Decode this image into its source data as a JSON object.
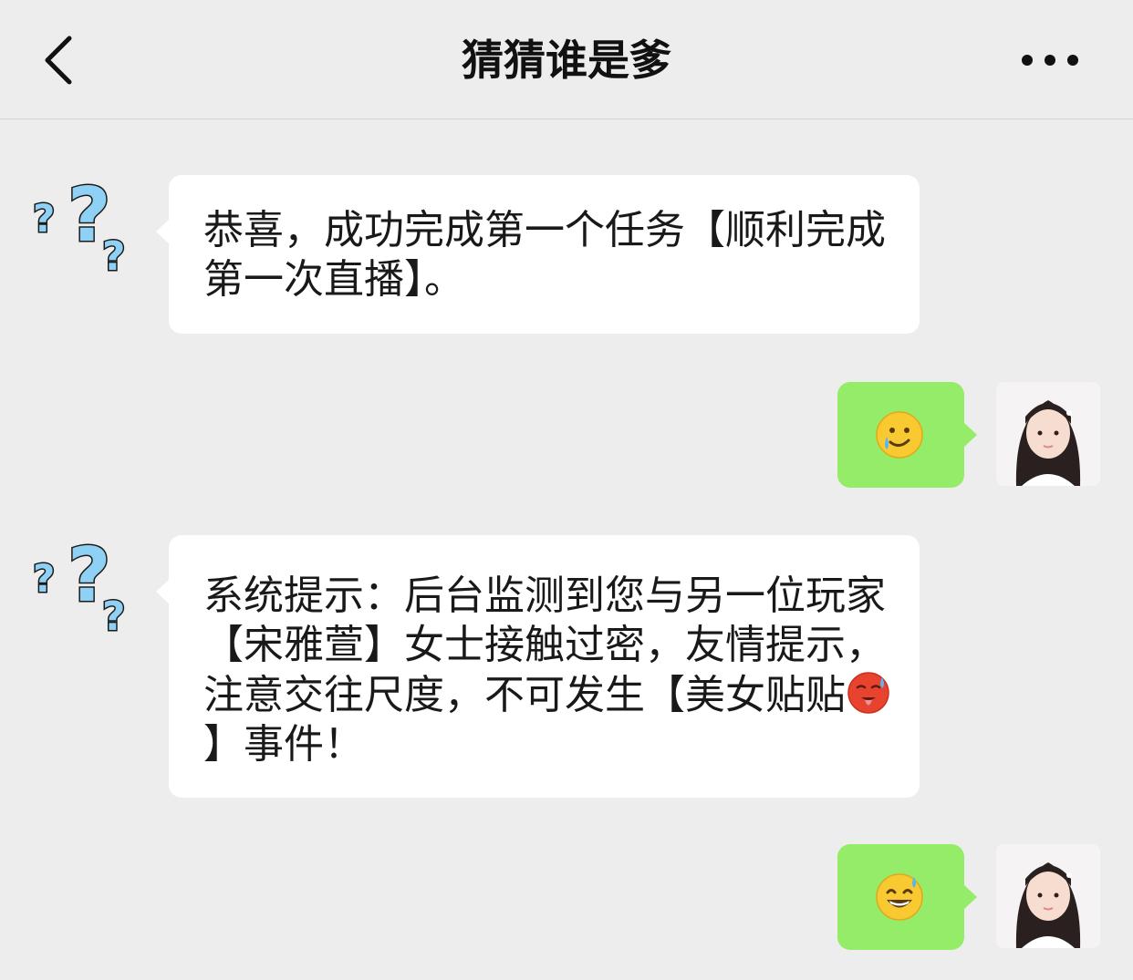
{
  "header": {
    "title": "猜猜谁是爹",
    "back_icon": "chevron-left-icon",
    "more_icon": "more-dots-icon"
  },
  "messages": [
    {
      "side": "left",
      "sender_avatar": "question-marks-avatar",
      "text": "恭喜，成功完成第一个任务【顺利完成第一次直播】。"
    },
    {
      "side": "right",
      "sender_avatar": "girl-avatar",
      "emoji": "smiling-face-with-tear-emoji"
    },
    {
      "side": "left",
      "sender_avatar": "question-marks-avatar",
      "text_before_emoji": "系统提示：后台监测到您与另一位玩家【宋雅萱】女士接触过密，友情提示，注意交往尺度，不可发生【美女贴贴",
      "inline_emoji": "hot-face-emoji",
      "text_after_emoji": "】事件！"
    },
    {
      "side": "right",
      "sender_avatar": "girl-avatar",
      "emoji": "grinning-face-with-sweat-emoji"
    }
  ],
  "colors": {
    "background": "#ededed",
    "received_bubble": "#ffffff",
    "sent_bubble": "#95ec69",
    "question_mark_fill": "#8fd0f5",
    "question_mark_outline": "#1a1a1a"
  }
}
